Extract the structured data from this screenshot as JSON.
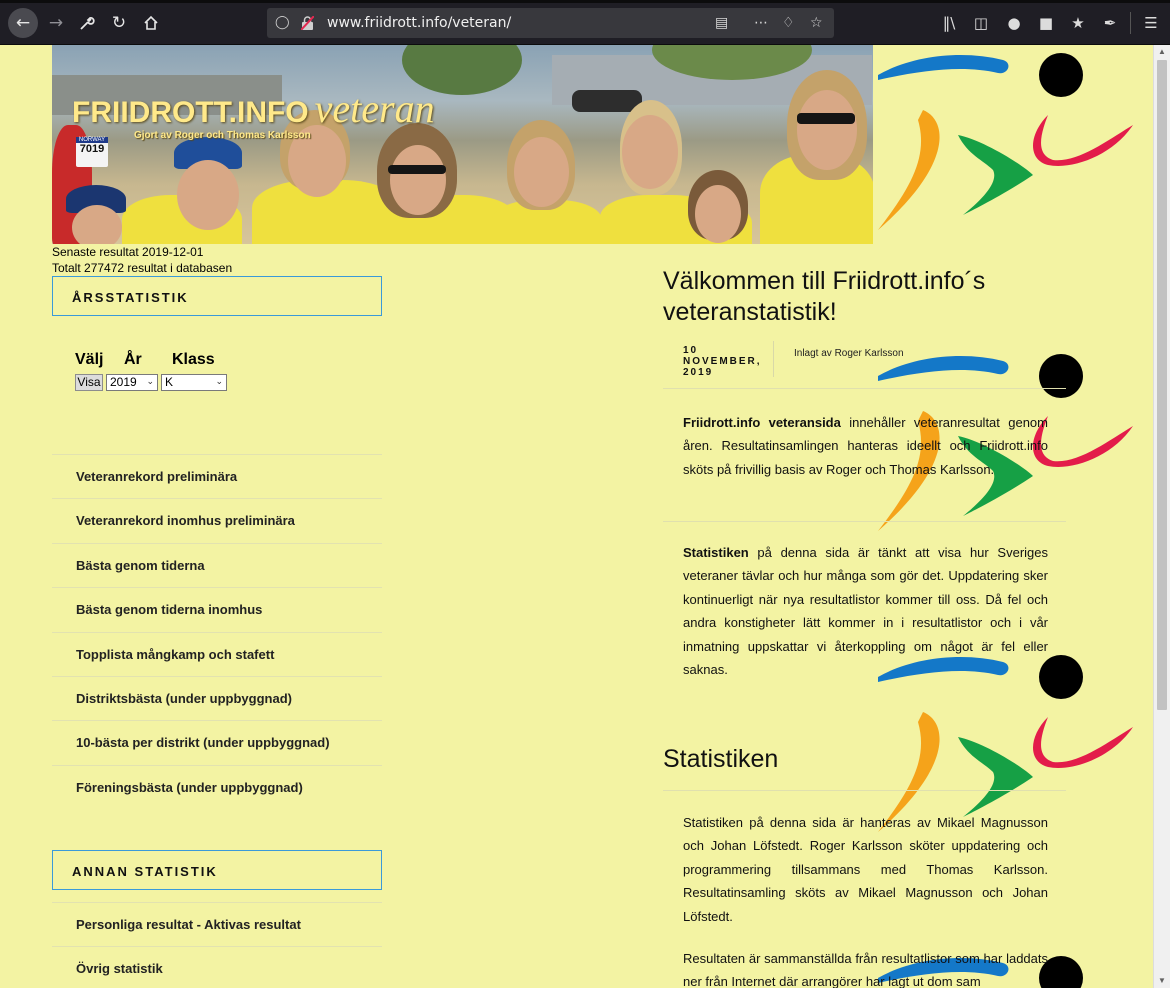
{
  "browser": {
    "url": "www.friidrott.info/veteran/",
    "nav_icons": [
      "back-arrow-icon",
      "forward-arrow-icon",
      "wrench-icon",
      "reload-icon",
      "home-icon"
    ],
    "toolbar_icons": [
      "library-icon",
      "sidebar-icon",
      "account-icon",
      "extension-icon",
      "extension-icon",
      "pen-icon",
      "menu-icon"
    ]
  },
  "banner": {
    "title_main": "FRIIDROTT.INFO",
    "title_script": "veteran",
    "byline": "Gjort av Roger och Thomas Karlsson",
    "bib_number": "7019",
    "bib_country": "NORWAY"
  },
  "status": {
    "latest": "Senaste resultat 2019-12-01",
    "total": "Totalt 277472 resultat i databasen"
  },
  "sidebar": {
    "year_stats": {
      "heading": "ÅRSSTATISTIK",
      "label_choose": "Välj",
      "label_year": "År",
      "label_class": "Klass",
      "button": "Visa",
      "year_value": "2019",
      "class_value": "K"
    },
    "links": [
      {
        "label": "Veteranrekord preliminära"
      },
      {
        "label": "Veteranrekord inomhus preliminära"
      },
      {
        "label": "Bästa genom tiderna"
      },
      {
        "label": "Bästa genom tiderna inomhus"
      },
      {
        "label": "Topplista mångkamp och stafett"
      },
      {
        "label": "Distriktsbästa (under uppbyggnad)"
      },
      {
        "label": "10-bästa per distrikt (under uppbyggnad)"
      },
      {
        "label": "Föreningsbästa (under uppbyggnad)"
      }
    ],
    "other_stats": {
      "heading": "ANNAN STATISTIK",
      "links": [
        {
          "label": "Personliga resultat - Aktivas resultat"
        },
        {
          "label": "Övrig statistik"
        }
      ]
    }
  },
  "post": {
    "title": "Välkommen till Friidrott.info´s veteranstatistik!",
    "date_day": "10",
    "date_month": "NOVEMBER,",
    "date_year": "2019",
    "author": "Inlagt av Roger Karlsson",
    "p1_bold": "Friidrott.info veteransida",
    "p1_rest": " innehåller veteranresultat genom åren. Resultatinsamlingen hanteras ideellt och Friidrott.info sköts på frivillig basis av Roger och Thomas Karlsson.",
    "p2_bold": "Statistiken",
    "p2_rest": " på denna sida är tänkt att visa hur Sveriges veteraner tävlar och hur många som gör det. Uppdatering sker kontinuerligt när nya resultatlistor kommer till oss. Då fel och andra konstigheter lätt kommer in i resultatlistor och i vår inmatning uppskattar vi återkoppling om något är fel eller saknas.",
    "section_title": "Statistiken",
    "p3": "Statistiken på denna sida är hanteras av Mikael Magnusson och Johan Löfstedt. Roger Karlsson sköter uppdatering och programmering tillsammans med Thomas Karlsson. Resultatinsamling sköts av Mikael Magnusson och Johan Löfstedt.",
    "p4": "Resultaten är sammanställda från resultatlistor som har laddats ner från Internet där arrangörer har lagt ut dom sam"
  },
  "colors": {
    "page_bg": "#f3f3a3",
    "box_border": "#3a9ad9",
    "logo_blue": "#1478c8",
    "logo_orange": "#f5a31a",
    "logo_green": "#16a045",
    "logo_red": "#e31c4a",
    "logo_black": "#000000"
  }
}
